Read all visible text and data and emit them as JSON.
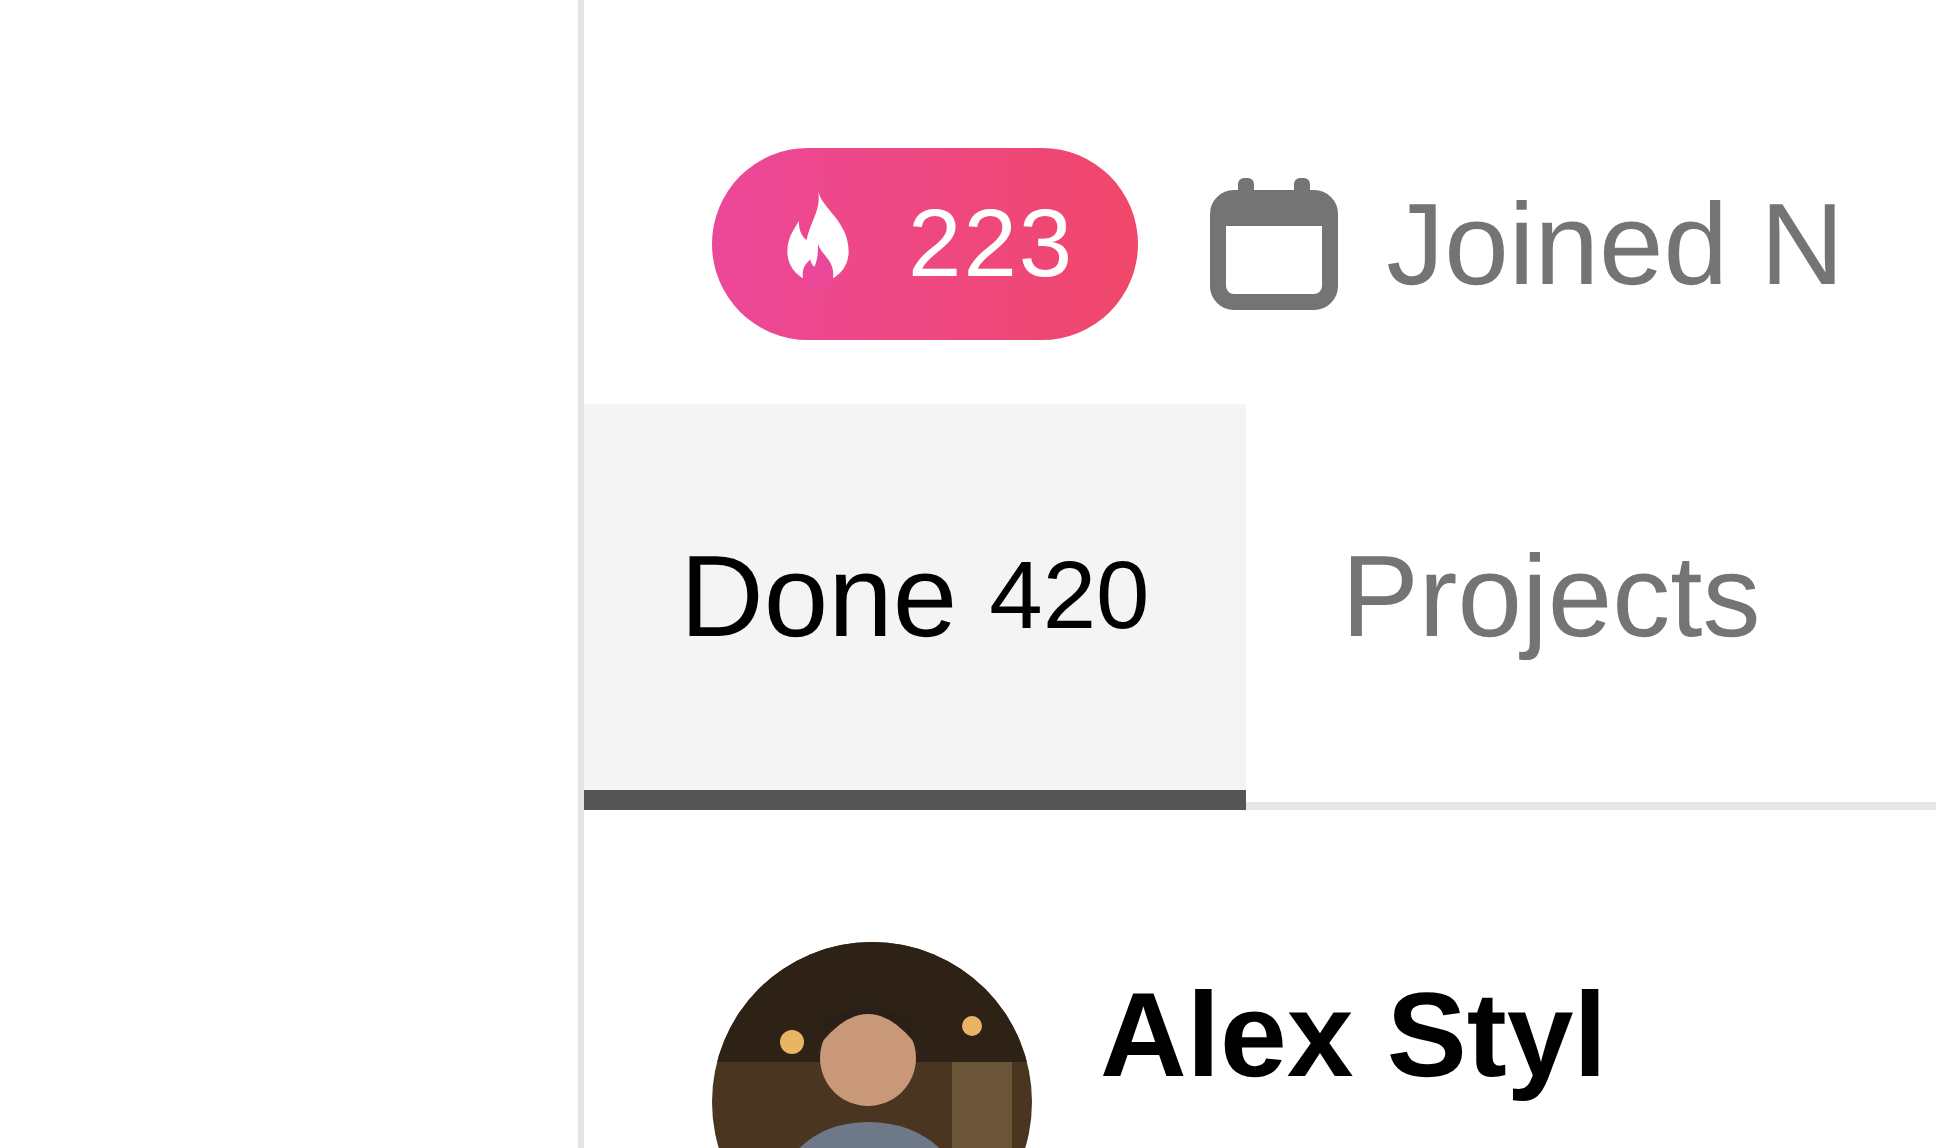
{
  "streak": {
    "count": "223"
  },
  "joined": {
    "text": "Joined N"
  },
  "tabs": [
    {
      "label": "Done",
      "count": "420",
      "selected": true
    },
    {
      "label": "Projects",
      "selected": false
    }
  ],
  "post": {
    "author": "Alex Styl"
  }
}
